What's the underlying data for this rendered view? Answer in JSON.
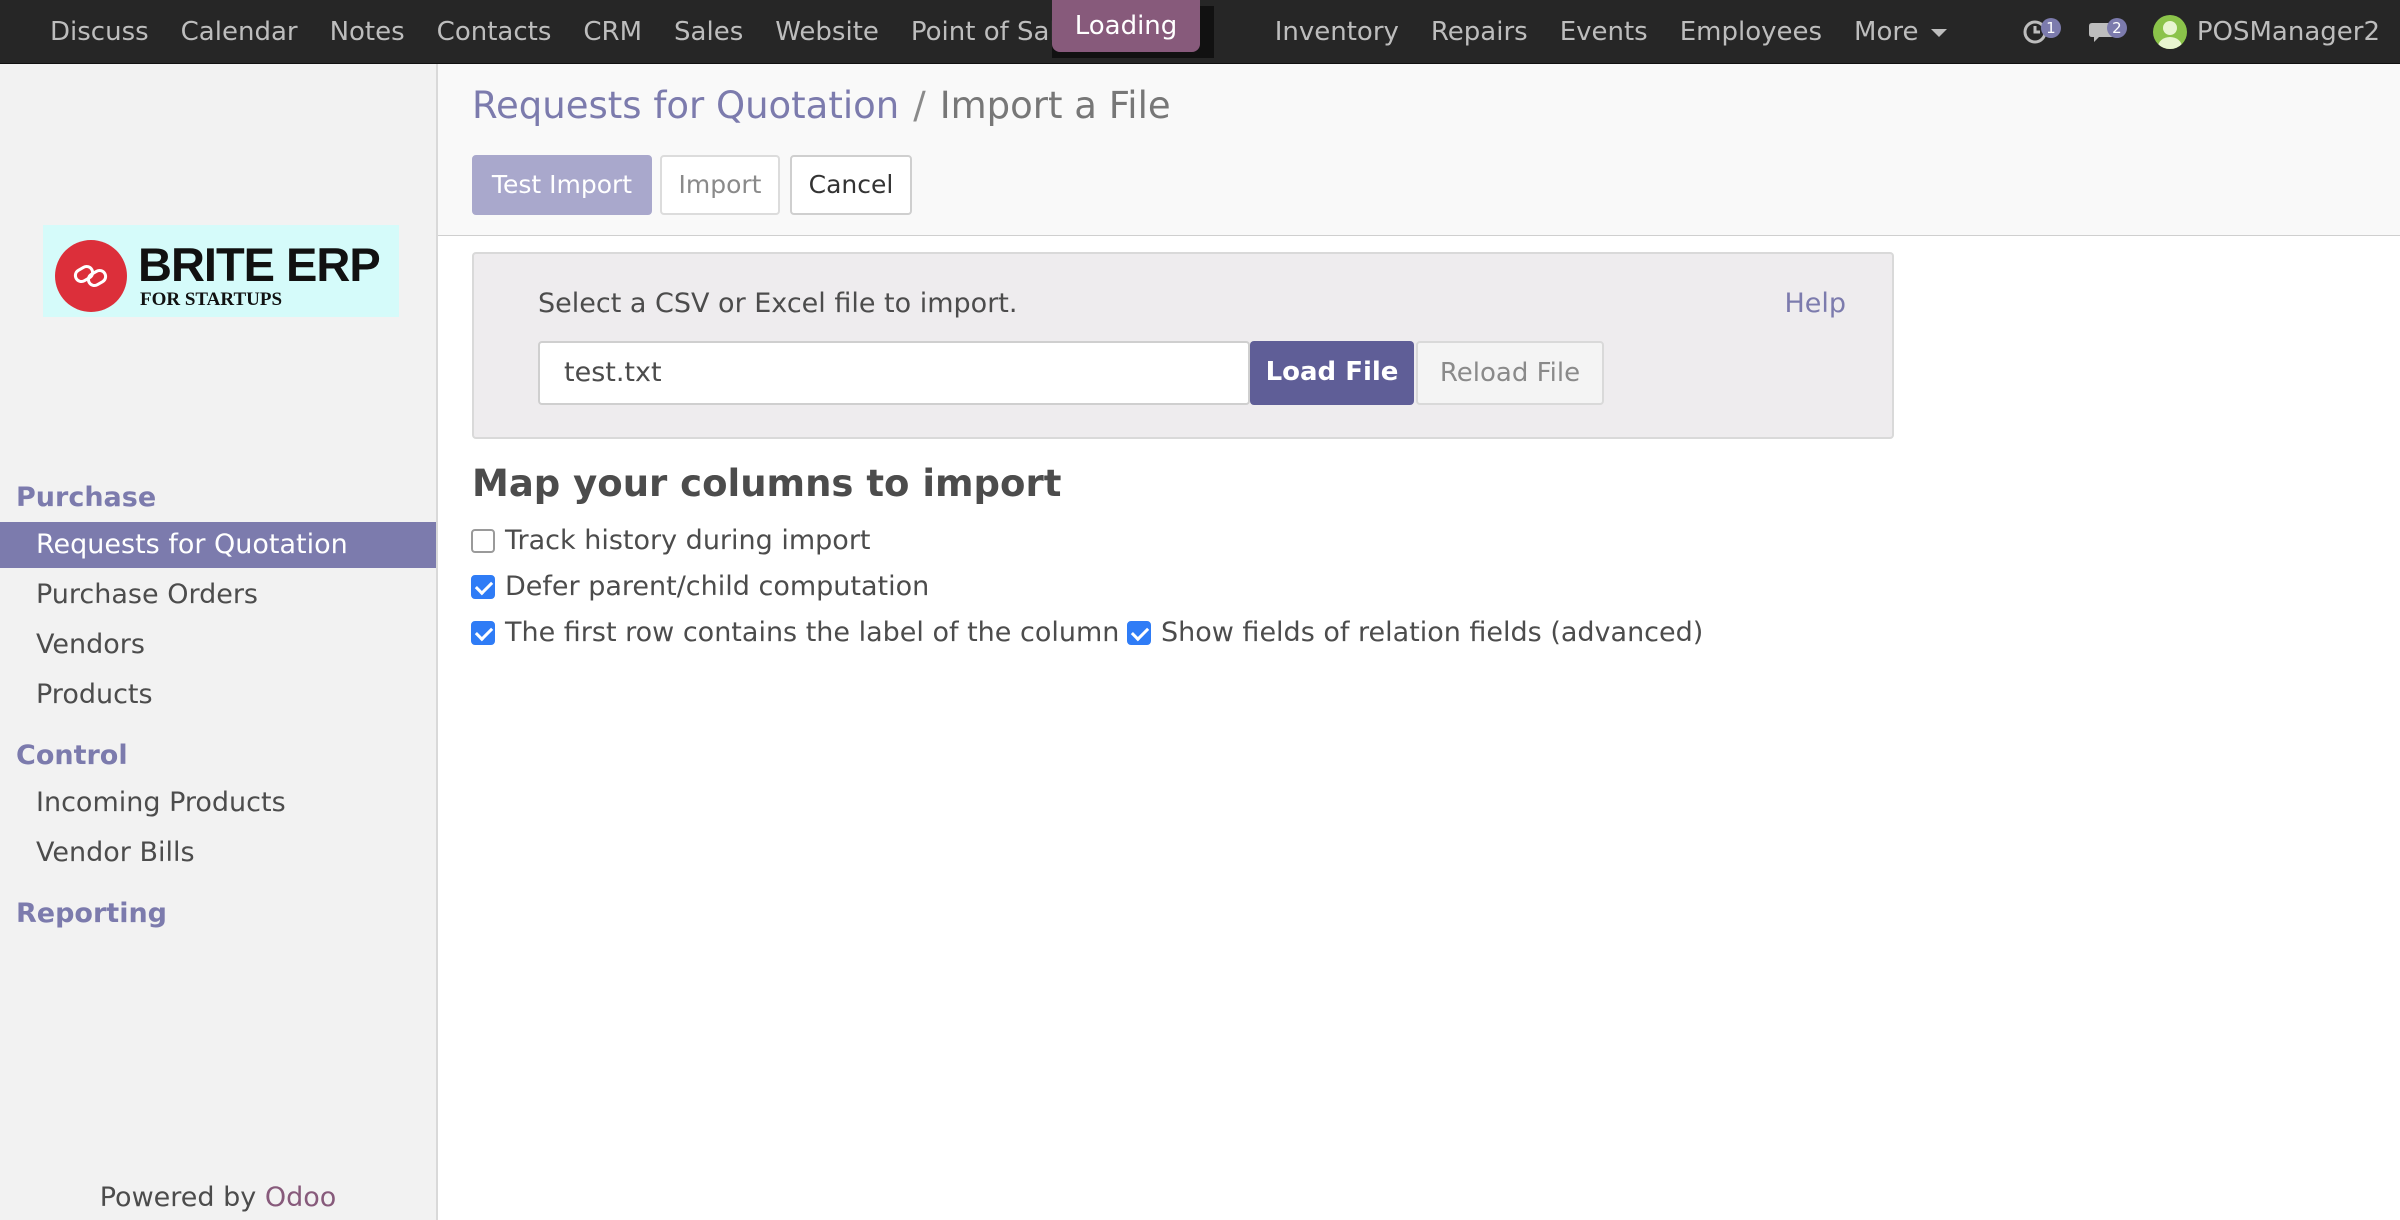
{
  "navbar": {
    "apps": [
      "Discuss",
      "Calendar",
      "Notes",
      "Contacts",
      "CRM",
      "Sales",
      "Website",
      "Point of Sale"
    ],
    "loading_label": "Loading",
    "apps_after": [
      "Inventory",
      "Repairs",
      "Events",
      "Employees"
    ],
    "more_label": "More",
    "activity_count": "1",
    "messages_count": "2",
    "user_name": "POSManager2"
  },
  "sidebar": {
    "logo_title": "BRITE ERP",
    "logo_subtitle": "FOR STARTUPS",
    "sections": [
      {
        "title": "Purchase",
        "items": [
          "Requests for Quotation",
          "Purchase Orders",
          "Vendors",
          "Products"
        ]
      },
      {
        "title": "Control",
        "items": [
          "Incoming Products",
          "Vendor Bills"
        ]
      },
      {
        "title": "Reporting",
        "items": []
      }
    ],
    "active_item": "Requests for Quotation",
    "powered_by": "Powered by",
    "powered_brand": "Odoo"
  },
  "control_panel": {
    "breadcrumb_parent": "Requests for Quotation",
    "breadcrumb_separator": "/",
    "breadcrumb_current": "Import a File",
    "test_import_label": "Test Import",
    "import_label": "Import",
    "cancel_label": "Cancel"
  },
  "file_select": {
    "prompt": "Select a CSV or Excel file to import.",
    "help_label": "Help",
    "file_name": "test.txt",
    "load_label": "Load File",
    "reload_label": "Reload File"
  },
  "mapping": {
    "heading": "Map your columns to import",
    "track_history": {
      "label": "Track history during import",
      "checked": false
    },
    "defer_computation": {
      "label": "Defer parent/child computation",
      "checked": true
    },
    "first_row_header": {
      "label": "The first row contains the label of the column",
      "checked": true
    },
    "show_relation_fields": {
      "label": "Show fields of relation fields (advanced)",
      "checked": true
    }
  },
  "colors": {
    "navbar_bg": "#262626",
    "accent": "#7c7bad",
    "primary_button": "#5f5e97",
    "loading_badge": "#875a7b",
    "checkbox_checked": "#2f7cf6"
  }
}
